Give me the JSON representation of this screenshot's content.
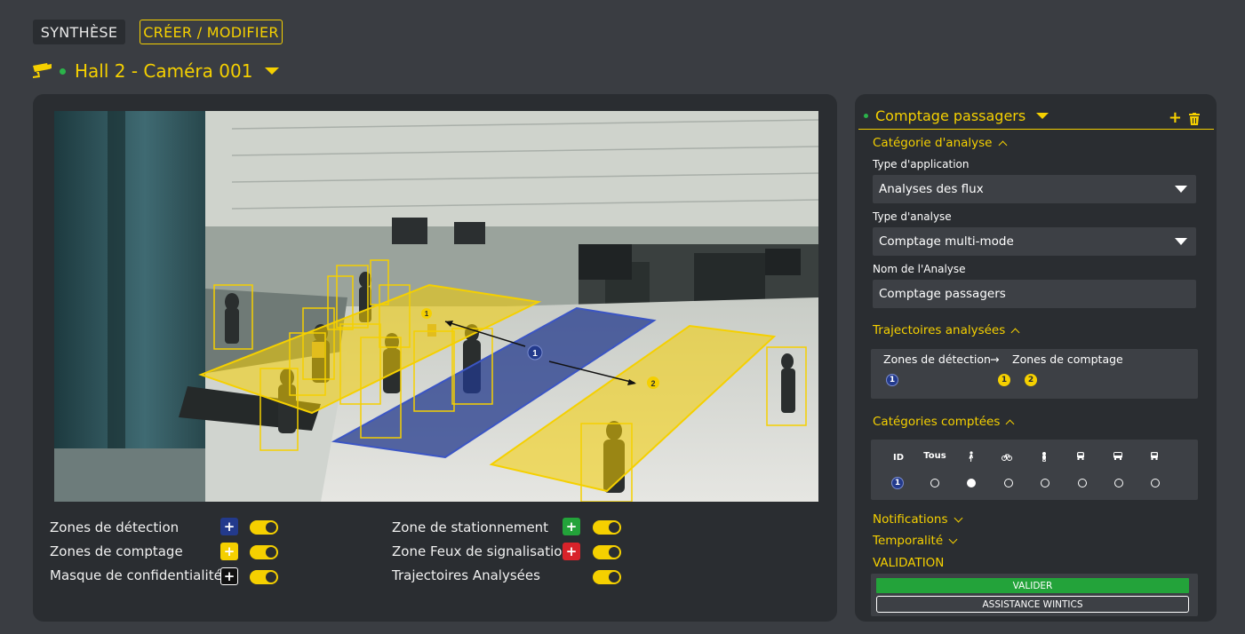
{
  "tabs": {
    "synthese": "SYNTHÈSE",
    "creer": "CRÉER / MODIFIER"
  },
  "camera": {
    "title": "Hall 2 - Caméra 001",
    "icon": "cctv-camera-icon",
    "status_color": "#2bb34a"
  },
  "colors": {
    "accent": "#f5d000",
    "blue_zone": "#233a8c",
    "green": "#23a33a",
    "red": "#d8232a",
    "panel": "#2a2d31",
    "background": "#3a3d42"
  },
  "video": {
    "zone_labels": {
      "detection": "1",
      "counting": "2",
      "counting_small": "1"
    }
  },
  "legend": {
    "detection": "Zones de détection",
    "counting": "Zones de comptage",
    "privacy": "Masque de confidentialité",
    "parking": "Zone de stationnement",
    "traffic_light": "Zone  Feux de signalisation",
    "trajectories": "Trajectoires Analysées",
    "plus": "+"
  },
  "panel": {
    "title": "Comptage passagers",
    "add": "+",
    "category_section": "Catégorie d'analyse",
    "app_type_label": "Type d'application",
    "app_type_value": "Analyses des flux",
    "analysis_type_label": "Type d'analyse",
    "analysis_type_value": "Comptage multi-mode",
    "name_label": "Nom de l'Analyse",
    "name_value": "Comptage passagers",
    "trajectories_section": "Trajectoires analysées",
    "detection_zones": "Zones de détection",
    "arrow": "→",
    "counting_zones": "Zones de comptage",
    "detection_ids": [
      "1"
    ],
    "counting_ids": [
      "1",
      "2"
    ],
    "counted_section": "Catégories comptées",
    "columns": {
      "id": "ID",
      "all": "Tous"
    },
    "category_icons": [
      "pedestrian-icon",
      "bicycle-icon",
      "motorcycle-icon",
      "car-icon",
      "bus-icon",
      "truck-icon"
    ],
    "row_id": "1",
    "selected_column": "pedestrian-icon",
    "notifications": "Notifications",
    "temporality": "Temporalité",
    "validation": "VALIDATION",
    "validate_button": "VALIDER",
    "assist_button": "ASSISTANCE WINTICS"
  }
}
